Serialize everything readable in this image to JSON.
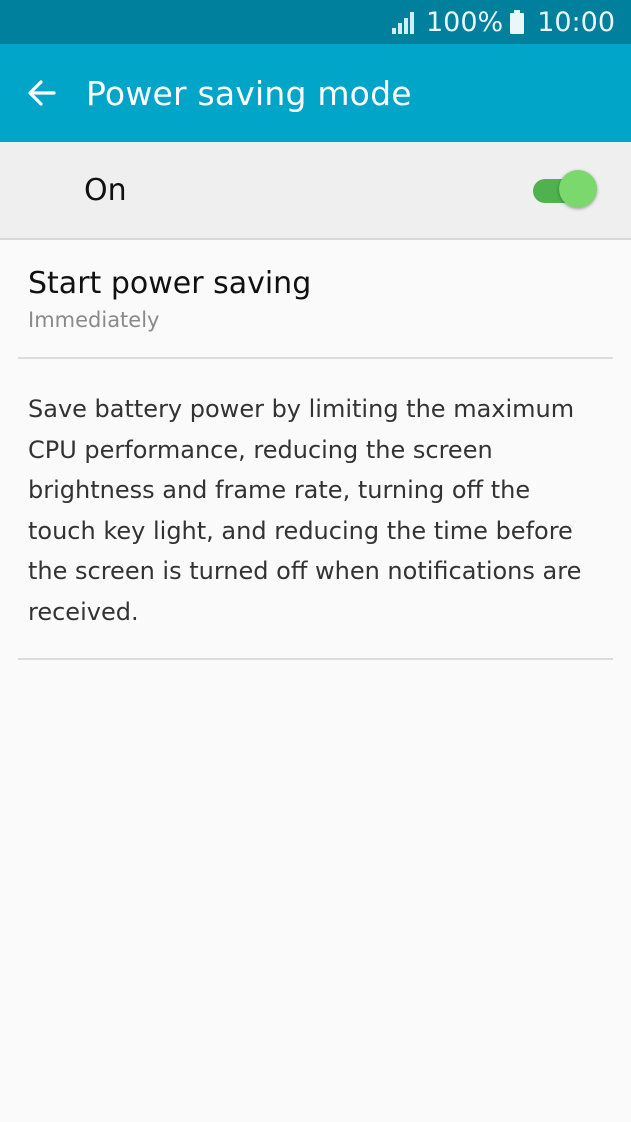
{
  "status_bar": {
    "battery_percent": "100%",
    "time": "10:00",
    "signal_icon": "signal-icon",
    "battery_icon": "battery-icon"
  },
  "app_bar": {
    "back_icon": "arrow-left-icon",
    "title": "Power saving mode"
  },
  "master_switch": {
    "label": "On",
    "enabled": true
  },
  "settings": {
    "start_power_saving": {
      "title": "Start power saving",
      "value": "Immediately"
    }
  },
  "description": "Save battery power by limiting the maximum CPU performance, reducing the screen brightness and frame rate, turning off the touch key light, and reducing the time before the screen is turned off when notifications are received.",
  "colors": {
    "status_bar": "#00809d",
    "app_bar": "#00a5c8",
    "toggle_on": "#4fb24f"
  }
}
